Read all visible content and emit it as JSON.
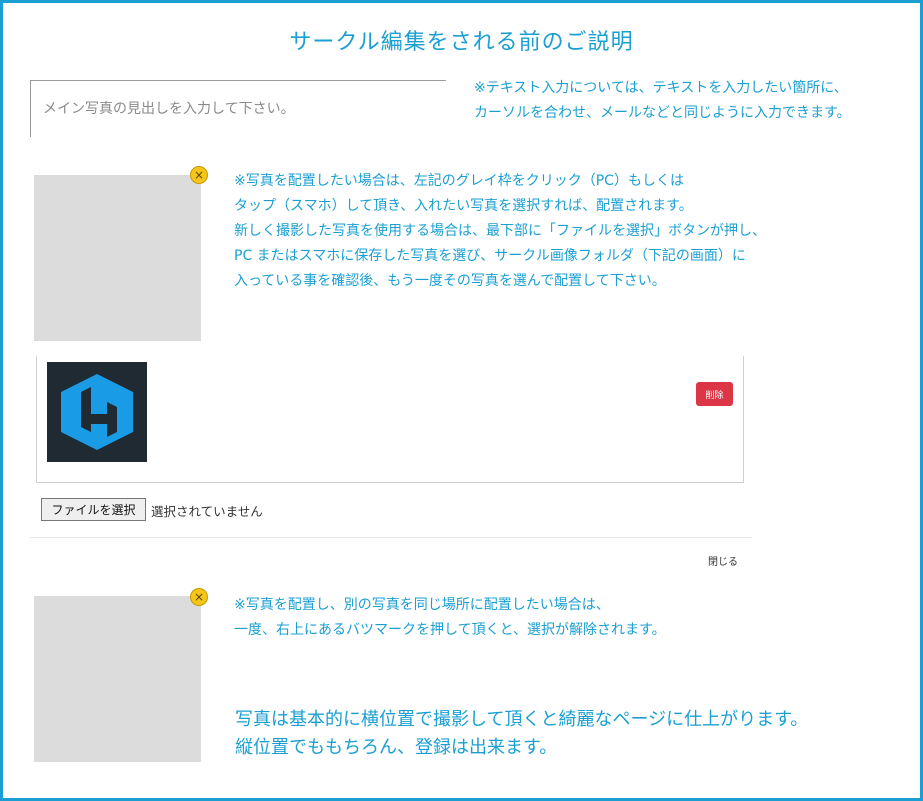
{
  "title": "サークル編集をされる前のご説明",
  "heading_input": {
    "placeholder": "メイン写真の見出しを入力して下さい。",
    "value": ""
  },
  "notes": {
    "text_input": [
      "※テキスト入力については、テキストを入力したい箇所に、",
      "カーソルを合わせ、メールなどと同じように入力できます。"
    ],
    "photo_place": [
      "※写真を配置したい場合は、左記のグレイ枠をクリック（PC）もしくは",
      "タップ（スマホ）して頂き、入れたい写真を選択すれば、配置されます。",
      "新しく撮影した写真を使用する場合は、最下部に「ファイルを選択」ボタンが押し、",
      "PC またはスマホに保存した写真を選び、サークル画像フォルダ（下記の画面）に",
      "入っている事を確認後、もう一度その写真を選んで配置して下さい。"
    ],
    "photo_replace": [
      "※写真を配置し、別の写真を同じ場所に配置したい場合は、",
      "一度、右上にあるバツマークを押して頂くと、選択が解除されます。"
    ],
    "orientation": [
      "写真は基本的に横位置で撮影して頂くと綺麗なページに仕上がります。",
      "縦位置でももちろん、登録は出来ます。"
    ]
  },
  "remove_glyph": "×",
  "panel": {
    "delete_label": "削除"
  },
  "file": {
    "button_label": "ファイルを選択",
    "status": "選択されていません"
  },
  "close_label": "閉じる",
  "colors": {
    "accent": "#1b9fd2",
    "delete": "#dc3545",
    "remove_badge": "#f5c518",
    "placeholder_box": "#dcdcdc",
    "thumb_blue": "#1a9be6",
    "thumb_bg": "#1f2a33"
  }
}
